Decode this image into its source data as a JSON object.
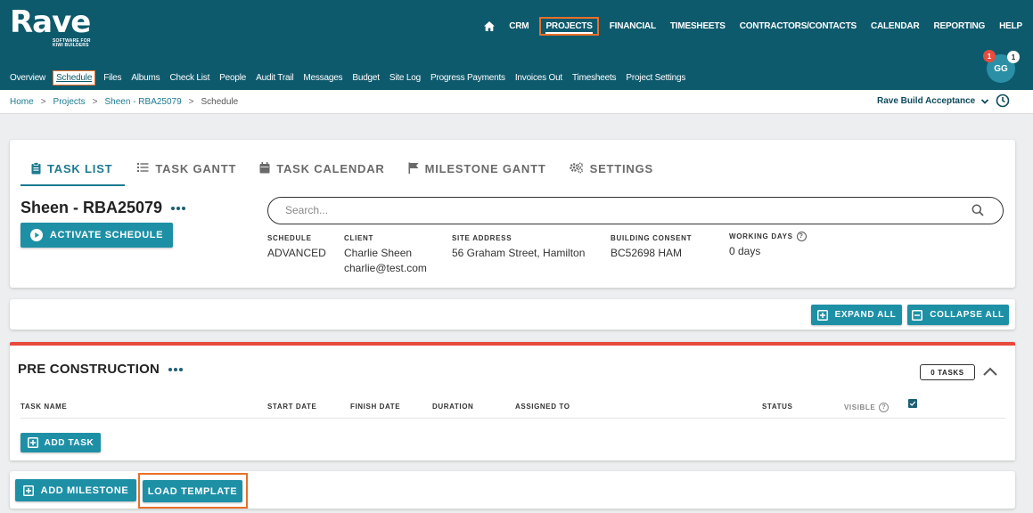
{
  "app": {
    "logo_text": "Rave",
    "logo_tagline_1": "SOFTWARE FOR",
    "logo_tagline_2": "KIWI BUILDERS"
  },
  "main_nav": {
    "items": [
      "CRM",
      "PROJECTS",
      "FINANCIAL",
      "TIMESHEETS",
      "CONTRACTORS/CONTACTS",
      "CALENDAR",
      "REPORTING",
      "HELP"
    ],
    "active": "PROJECTS"
  },
  "sub_nav": {
    "items": [
      "Overview",
      "Schedule",
      "Files",
      "Albums",
      "Check List",
      "People",
      "Audit Trail",
      "Messages",
      "Budget",
      "Site Log",
      "Progress Payments",
      "Invoices Out",
      "Timesheets",
      "Project Settings"
    ],
    "active": "Schedule"
  },
  "user": {
    "initials": "GG",
    "badge_red": "1",
    "badge_white": "1"
  },
  "breadcrumb": {
    "home": "Home",
    "projects": "Projects",
    "project": "Sheen - RBA25079",
    "current": "Schedule",
    "separator": ">"
  },
  "project_select": {
    "value": "Rave Build Acceptance"
  },
  "tabs": {
    "task_list": "TASK LIST",
    "task_gantt": "TASK GANTT",
    "task_calendar": "TASK CALENDAR",
    "milestone_gantt": "MILESTONE GANTT",
    "settings": "SETTINGS"
  },
  "project": {
    "title": "Sheen - RBA25079",
    "activate_label": "ACTIVATE SCHEDULE"
  },
  "search": {
    "placeholder": "Search..."
  },
  "info": {
    "schedule_label": "SCHEDULE",
    "schedule_value": "ADVANCED",
    "client_label": "CLIENT",
    "client_name": "Charlie Sheen",
    "client_email": "charlie@test.com",
    "site_label": "SITE ADDRESS",
    "site_value": "56 Graham Street, Hamilton",
    "consent_label": "BUILDING CONSENT",
    "consent_value": "BC52698 HAM",
    "days_label": "WORKING DAYS",
    "days_value": "0 days",
    "help_glyph": "?"
  },
  "controls": {
    "expand_all": "EXPAND ALL",
    "collapse_all": "COLLAPSE ALL"
  },
  "section": {
    "title": "PRE CONSTRUCTION",
    "task_count": "0 TASKS",
    "columns": {
      "task_name": "TASK NAME",
      "start_date": "START DATE",
      "finish_date": "FINISH DATE",
      "duration": "DURATION",
      "assigned_to": "ASSIGNED TO",
      "status": "STATUS",
      "visible": "VISIBLE"
    },
    "visible_checked": true,
    "add_task": "ADD TASK",
    "accent_color": "#e8493d"
  },
  "footer_actions": {
    "add_milestone": "ADD MILESTONE",
    "load_template": "LOAD TEMPLATE"
  },
  "colors": {
    "header_bg": "#0e5a6d",
    "teal_button": "#1e90a6",
    "highlight": "#e8702a"
  }
}
